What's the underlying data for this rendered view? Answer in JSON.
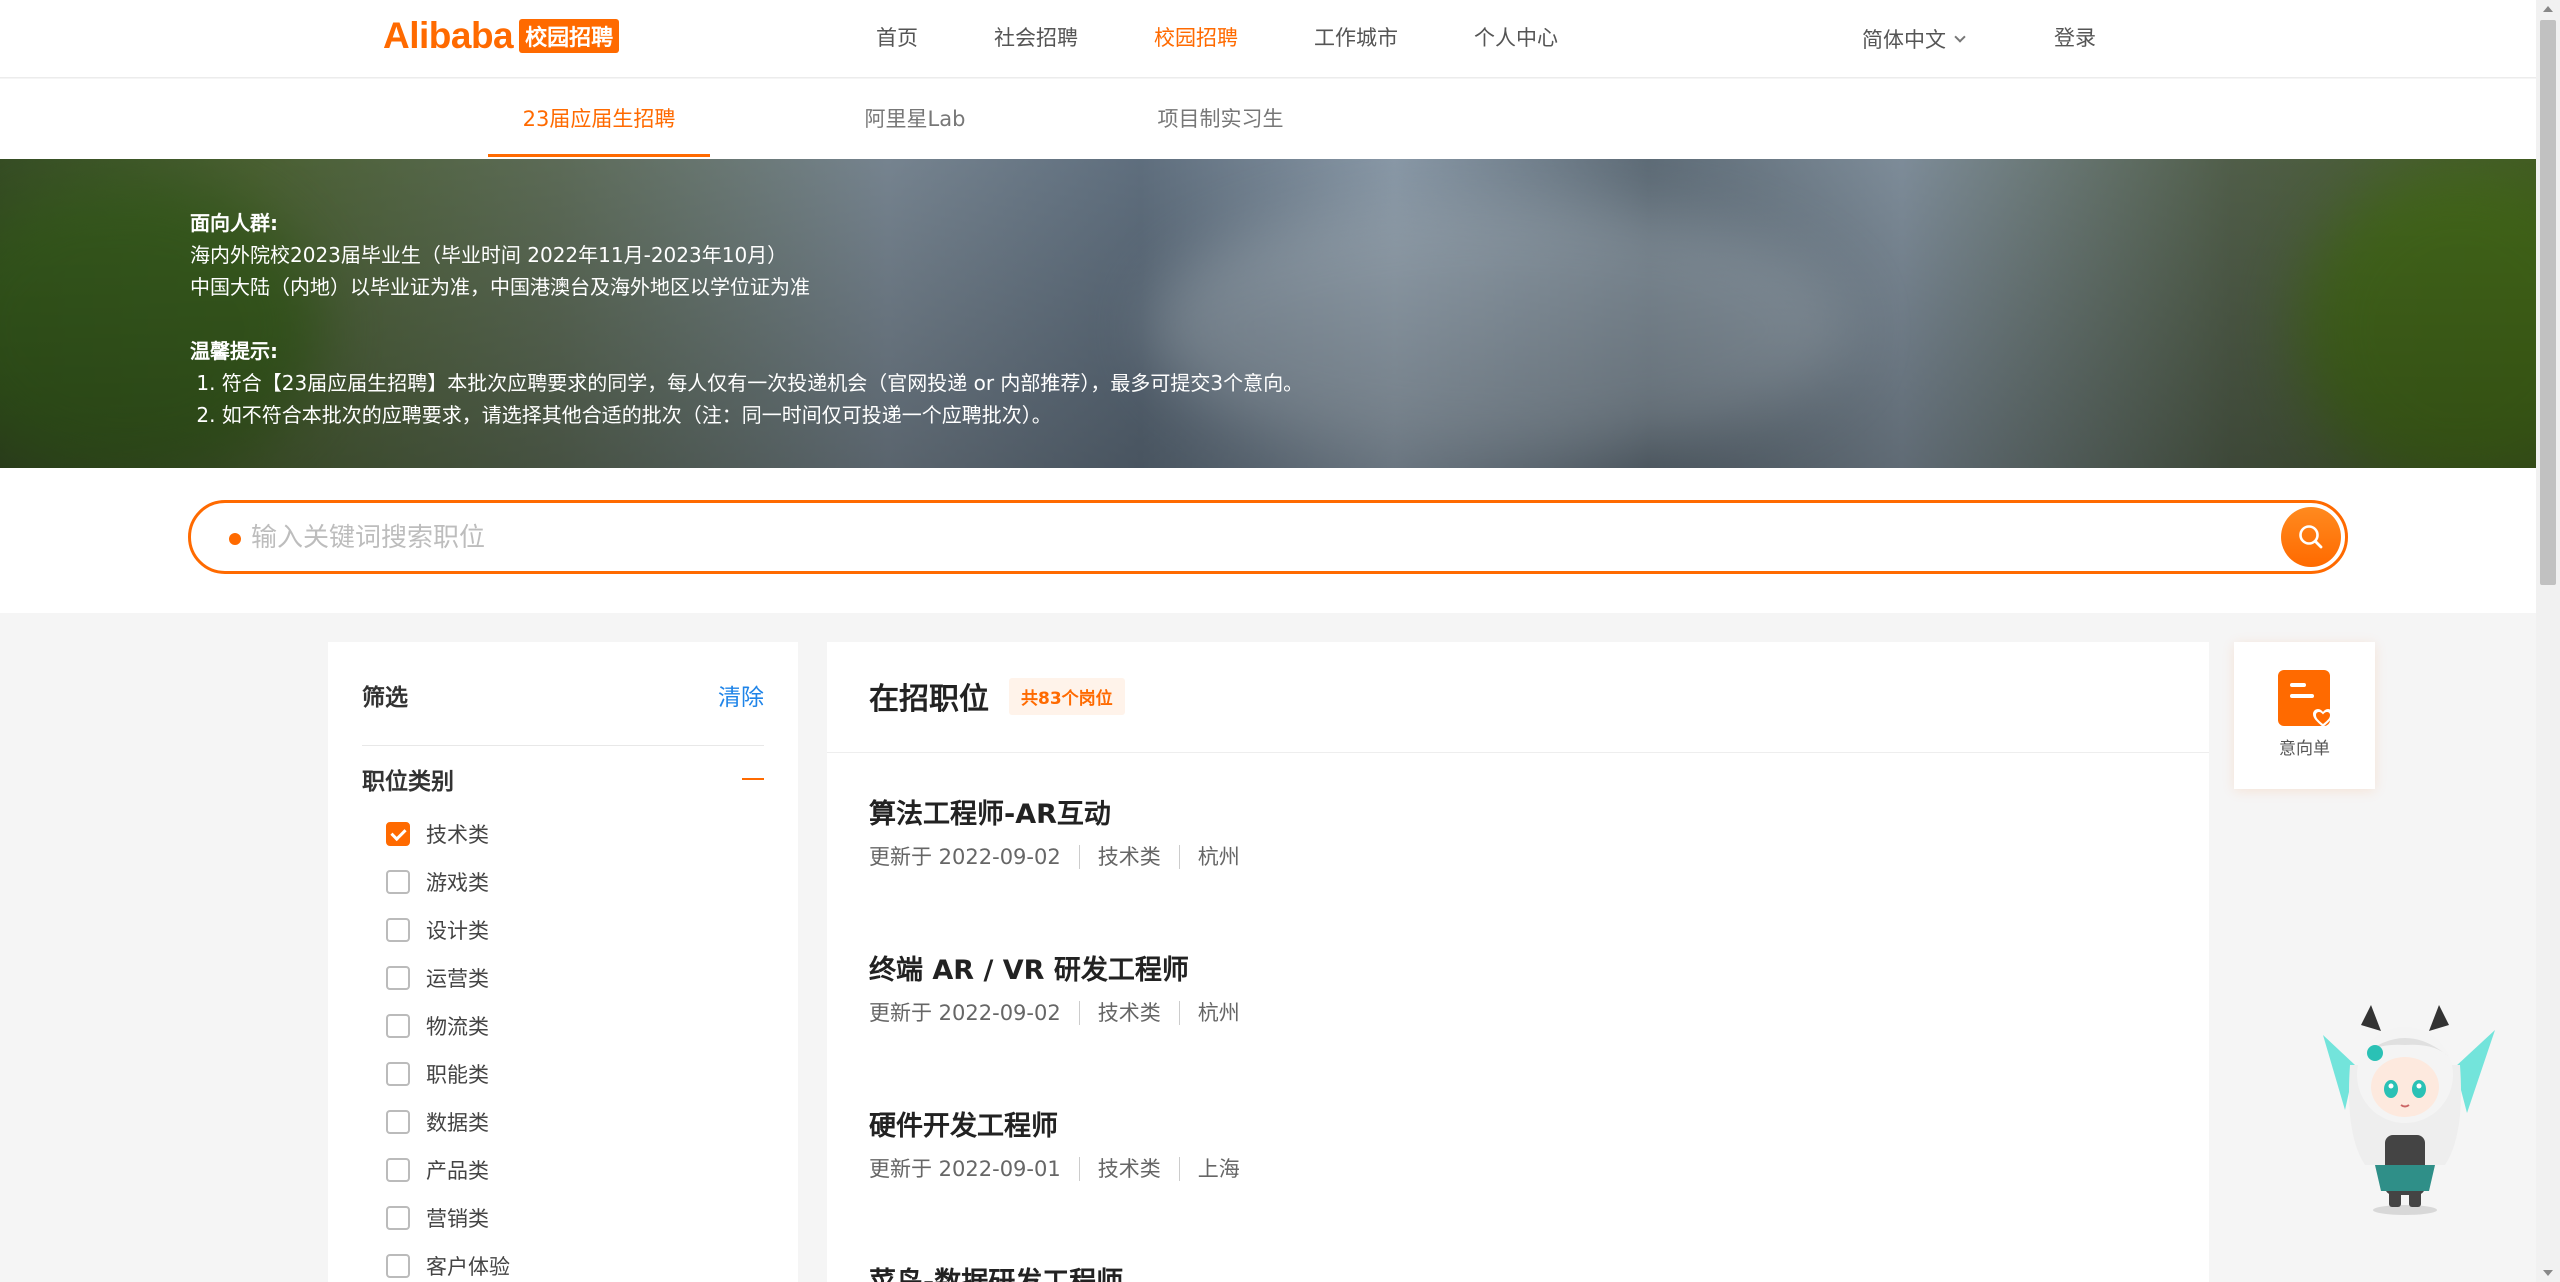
{
  "brand": {
    "logo_text": "Alibaba",
    "logo_badge": "校园招聘"
  },
  "topnav": {
    "items": [
      "首页",
      "社会招聘",
      "校园招聘",
      "工作城市",
      "个人中心"
    ],
    "active_index": 2,
    "language": "简体中文",
    "login": "登录"
  },
  "subnav": {
    "tabs": [
      "23届应届生招聘",
      "阿里星Lab",
      "项目制实习生"
    ],
    "active_index": 0
  },
  "banner": {
    "audience_heading": "面向人群:",
    "audience_lines": [
      "海内外院校2023届毕业生（毕业时间  2022年11月-2023年10月）",
      "中国大陆（内地）以毕业证为准，中国港澳台及海外地区以学位证为准"
    ],
    "tips_heading": "温馨提示:",
    "tips_lines": [
      " 1. 符合【23届应届生招聘】本批次应聘要求的同学，每人仅有一次投递机会（官网投递 or 内部推荐），最多可提交3个意向。",
      " 2. 如不符合本批次的应聘要求，请选择其他合适的批次（注：同一时间仅可投递一个应聘批次）。"
    ]
  },
  "search": {
    "placeholder": "输入关键词搜索职位",
    "value": ""
  },
  "filter": {
    "title": "筛选",
    "clear": "清除",
    "category_title": "职位类别",
    "categories": [
      {
        "label": "技术类",
        "checked": true
      },
      {
        "label": "游戏类",
        "checked": false
      },
      {
        "label": "设计类",
        "checked": false
      },
      {
        "label": "运营类",
        "checked": false
      },
      {
        "label": "物流类",
        "checked": false
      },
      {
        "label": "职能类",
        "checked": false
      },
      {
        "label": "数据类",
        "checked": false
      },
      {
        "label": "产品类",
        "checked": false
      },
      {
        "label": "营销类",
        "checked": false
      },
      {
        "label": "客户体验",
        "checked": false
      }
    ]
  },
  "jobs": {
    "title": "在招职位",
    "count": "共83个岗位",
    "items": [
      {
        "title": "算法工程师-AR互动",
        "updated": "更新于 2022-09-02",
        "category": "技术类",
        "city": "杭州"
      },
      {
        "title": "终端 AR / VR 研发工程师",
        "updated": "更新于 2022-09-02",
        "category": "技术类",
        "city": "杭州"
      },
      {
        "title": "硬件开发工程师",
        "updated": "更新于 2022-09-01",
        "category": "技术类",
        "city": "上海"
      },
      {
        "title": "菜鸟-数据研发工程师",
        "updated": "",
        "category": "",
        "city": ""
      }
    ]
  },
  "wishlist": {
    "label": "意向单",
    "icon": "wishlist-heart-icon"
  },
  "colors": {
    "accent": "#ff6a00",
    "link": "#1f84e8"
  }
}
